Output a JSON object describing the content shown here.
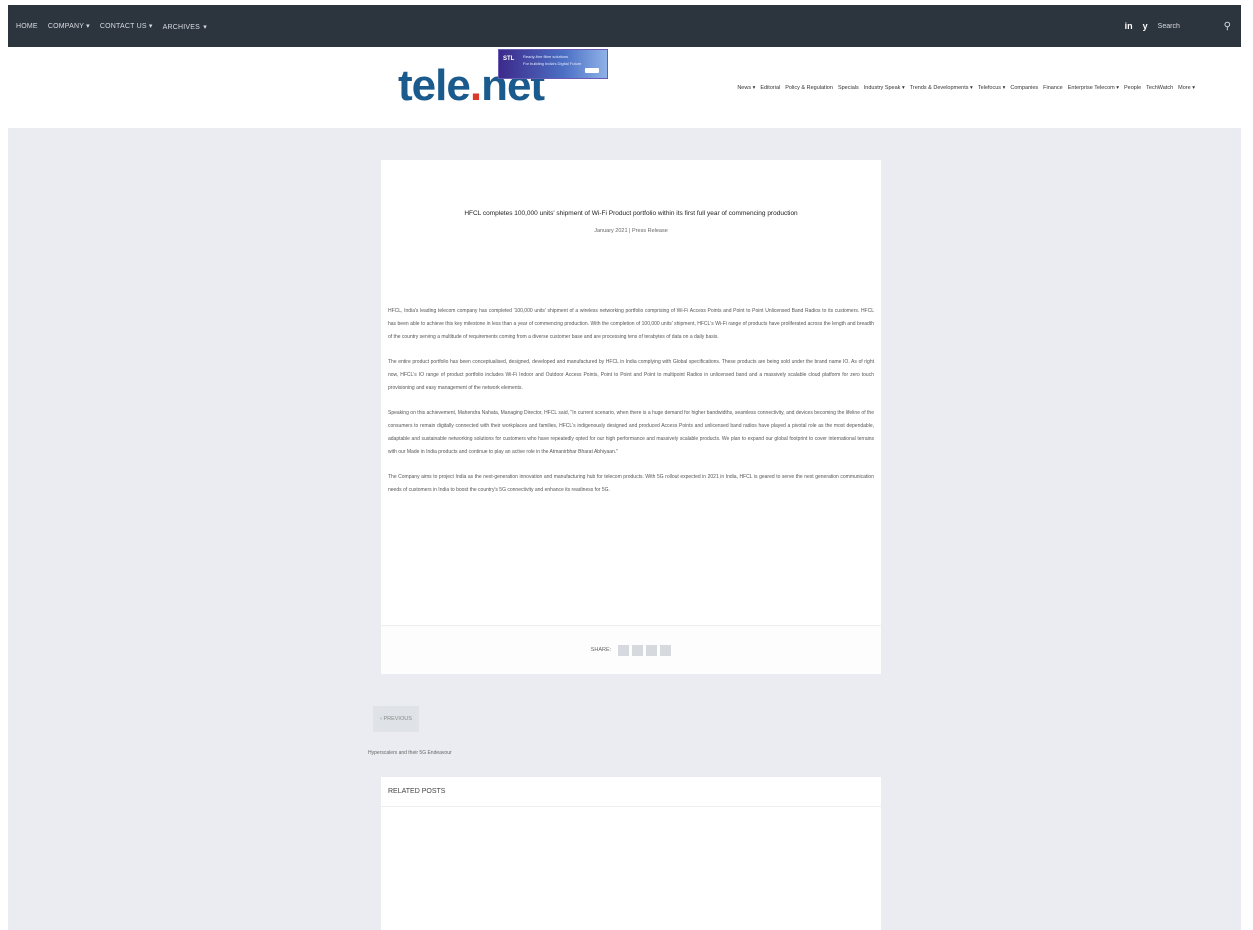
{
  "topnav": {
    "items": [
      "HOME",
      "COMPANY",
      "CONTACT US",
      "ARCHIVES"
    ],
    "dropdown_marker": "▾"
  },
  "topright": {
    "social_linkedin": "in",
    "social_twitter": "y",
    "search_placeholder": "Search",
    "search_icon": "⚲"
  },
  "header": {
    "logo_tele": "tele",
    "logo_dot": ".",
    "logo_net": "net",
    "banner_brand": "STL",
    "banner_line1": "Ready-fine fibre solutions",
    "banner_line2": "For building India's Digital Future",
    "nav": [
      "News ▾",
      "Editorial",
      "Policy & Regulation",
      "Specials",
      "Industry Speak ▾",
      "Trends & Developments ▾",
      "Telefocus ▾",
      "Companies",
      "Finance",
      "Enterprise Telecom ▾",
      "People",
      "TechWatch",
      "More ▾"
    ]
  },
  "article": {
    "title": "HFCL completes 100,000 units' shipment of Wi-Fi Product portfolio within its first full year of commencing production",
    "meta": "January 2021 | Press Release",
    "paragraphs": [
      "HFCL, India's leading telecom company has completed '100,000 units' shipment of a wireless networking portfolio comprising of Wi-Fi Access Points and Point to Point Unlicensed Band Radios to its customers. HFCL has been able to achieve this key milestone in less than a year of commencing production. With the completion of 100,000 units' shipment, HFCL's Wi-Fi range of products have proliferated across the length and breadth of the country serving a multitude of requirements coming from a diverse customer base and are processing tens of terabytes of data on a daily basis.",
      "The entire product portfolio has been conceptualised, designed, developed and manufactured by HFCL in India complying with Global specifications. These products are being sold under the brand name IO. As of right now, HFCL's IO range of product portfolio includes Wi-Fi Indoor and Outdoor Access Points, Point to Point and Point to multipoint Radios in unlicensed band and a massively scalable cloud platform for zero touch provisioning and easy management of the network elements.",
      "Speaking on this achievement, Mahendra Nahata, Managing Director, HFCL said, \"In current scenario, when there is a huge demand for higher bandwidths, seamless connectivity, and devices becoming the lifeline of the consumers to remain digitally connected with their workplaces and families, HFCL's indigenously designed and produced Access Points and unlicensed band radios have played a pivotal role as the most dependable, adaptable and sustainable networking solutions for customers who have repeatedly opted for our high performance and massively scalable products. We plan to expand our global footprint to cover international terrains with our Made in India products and continue to play an active role in the Atmanirbhar Bharat Abhiyaan.\"",
      "The Company aims to project India as the next-generation innovation and manufacturing hub for telecom products. With 5G rollout expected in 2021 in India, HFCL is geared to serve the next generation communication needs of customers in India to boost the country's 5G connectivity and enhance its readiness for 5G."
    ],
    "share_label": "SHARE:"
  },
  "pagination": {
    "prev_label": "‹ PREVIOUS",
    "prev_post": "Hyperscalers and their 5G Endeavour"
  },
  "related": {
    "heading": "RELATED POSTS"
  }
}
